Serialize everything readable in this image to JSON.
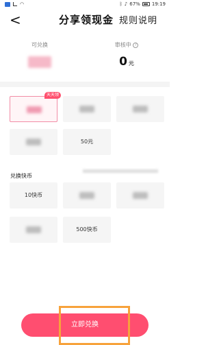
{
  "status_bar": {
    "battery_text": "67%",
    "time": "19:19"
  },
  "header": {
    "title": "分享领现金",
    "rules_label": "规则说明",
    "back_glyph": "<"
  },
  "stats": {
    "redeemable_label": "可兑换",
    "under_review_label": "审核中",
    "under_review_value": "0",
    "currency_unit": "元"
  },
  "exchange_options_1": {
    "badge": "天天领",
    "tiles": [
      "",
      "",
      "",
      "",
      "50元",
      ""
    ]
  },
  "section_title": "兑换快币",
  "exchange_options_2": {
    "tiles": [
      "10快币",
      "",
      "",
      "",
      "500快币"
    ]
  },
  "cta": {
    "label": "立即兑换"
  },
  "colors": {
    "accent": "#ff4e70",
    "highlight_outline": "#f7a23b",
    "badge": "#ff4f6d"
  }
}
